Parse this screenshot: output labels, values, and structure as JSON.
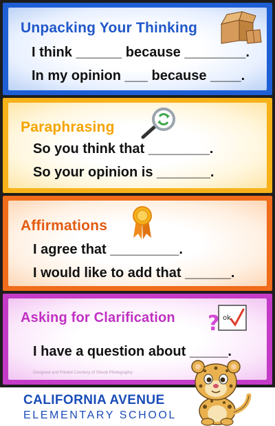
{
  "panels": [
    {
      "title": "Unpacking Your Thinking",
      "icon": "open-box-icon",
      "lines": [
        "I think ______ because ________.",
        "In my opinion ___ because ____."
      ]
    },
    {
      "title": "Paraphrasing",
      "icon": "magnifier-recycle-icon",
      "lines": [
        "So you think that ________.",
        "So your opinion is _______."
      ]
    },
    {
      "title": "Affirmations",
      "icon": "award-ribbon-icon",
      "lines": [
        "I agree that _________.",
        "I would like to add that ______."
      ]
    },
    {
      "title": "Asking for Clarification",
      "icon": "question-checkbox-icon",
      "icon_text": "ok",
      "lines": [
        "I have a question about _____."
      ]
    }
  ],
  "credit": "Designed and Printed Courtesy of Shoob Photography",
  "school": {
    "line1": "CALIFORNIA AVENUE",
    "line2": "ELEMENTARY SCHOOL"
  },
  "colors": {
    "blue": "#1f5fd6",
    "yellow": "#f7b21a",
    "orange": "#ef6c1a",
    "magenta": "#c43bc7"
  }
}
